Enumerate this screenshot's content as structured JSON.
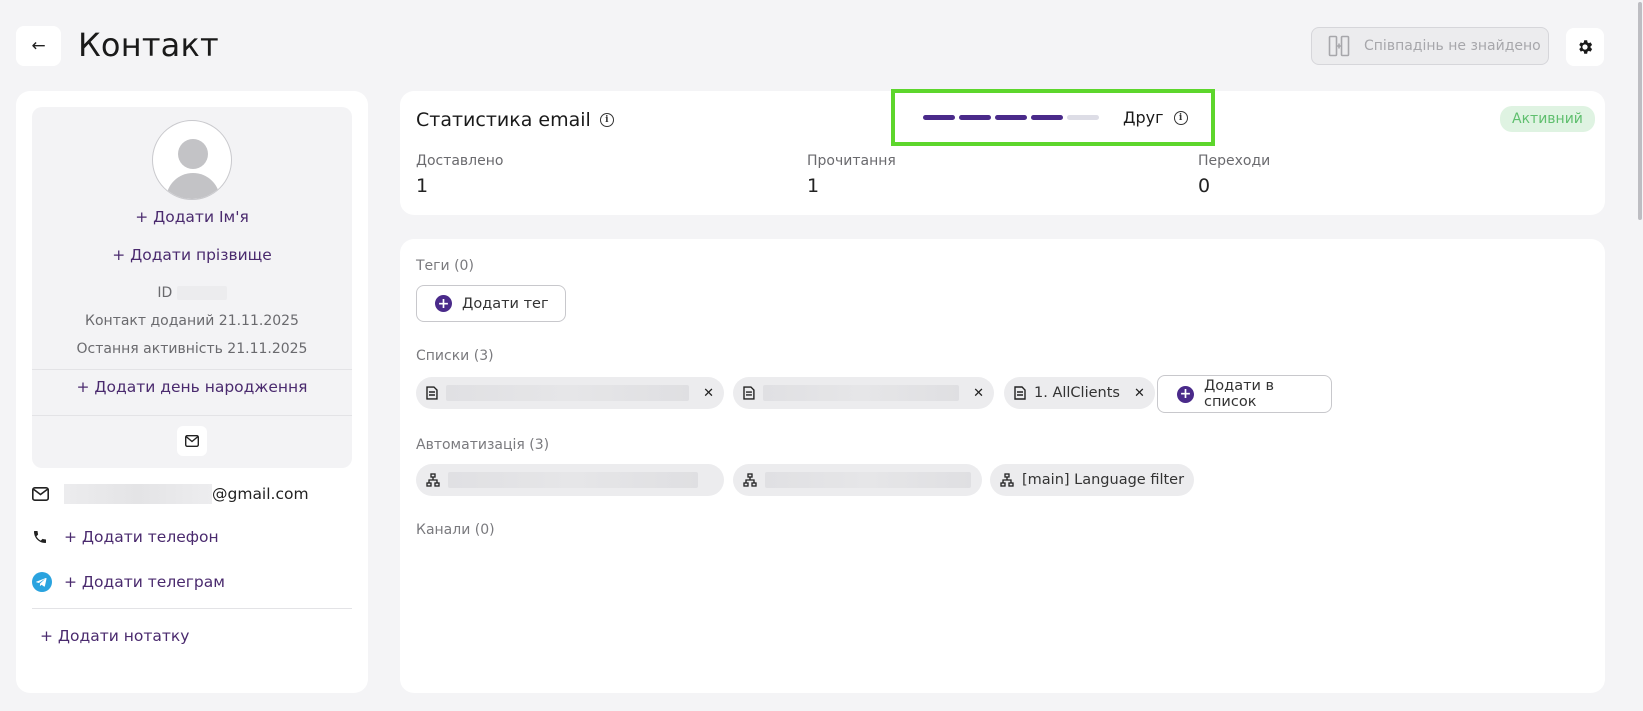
{
  "header": {
    "back_icon": "arrow-left-icon",
    "title": "Контакт",
    "duplicates_button": "Співпадінь не знайдено",
    "settings_icon": "gear-icon"
  },
  "profile": {
    "add_first_name": "+ Додати Ім'я",
    "add_last_name": "+ Додати прізвище",
    "id_label": "ID",
    "added": "Контакт доданий 21.11.2025",
    "last_activity": "Остання активність 21.11.2025",
    "add_birthday": "+ Додати день народження"
  },
  "contacts": {
    "email_domain": "@gmail.com",
    "add_phone": "+ Додати телефон",
    "add_telegram": "+ Додати телеграм",
    "add_note": "+ Додати нотатку"
  },
  "stats": {
    "title": "Статистика email",
    "level_label": "Друг",
    "level_value": 4,
    "level_max": 5,
    "status": "Активний",
    "items": [
      {
        "label": "Доставлено",
        "value": "1"
      },
      {
        "label": "Прочитання",
        "value": "1"
      },
      {
        "label": "Переходи",
        "value": "0"
      }
    ]
  },
  "main": {
    "tags_label": "Теги (0)",
    "add_tag": "Додати тег",
    "lists_label": "Списки (3)",
    "list_chip_3": "1. AllClients",
    "add_to_list": "Додати в список",
    "automation_label": "Автоматизація (3)",
    "automation_chip_3": "[main] Language filter",
    "channels_label": "Канали (0)"
  },
  "colors": {
    "accent": "#4a2a8a",
    "link": "#4a2a6e",
    "status_bg": "#dff3e2",
    "status_text": "#5fbf6e",
    "highlight": "#5dd62c"
  }
}
